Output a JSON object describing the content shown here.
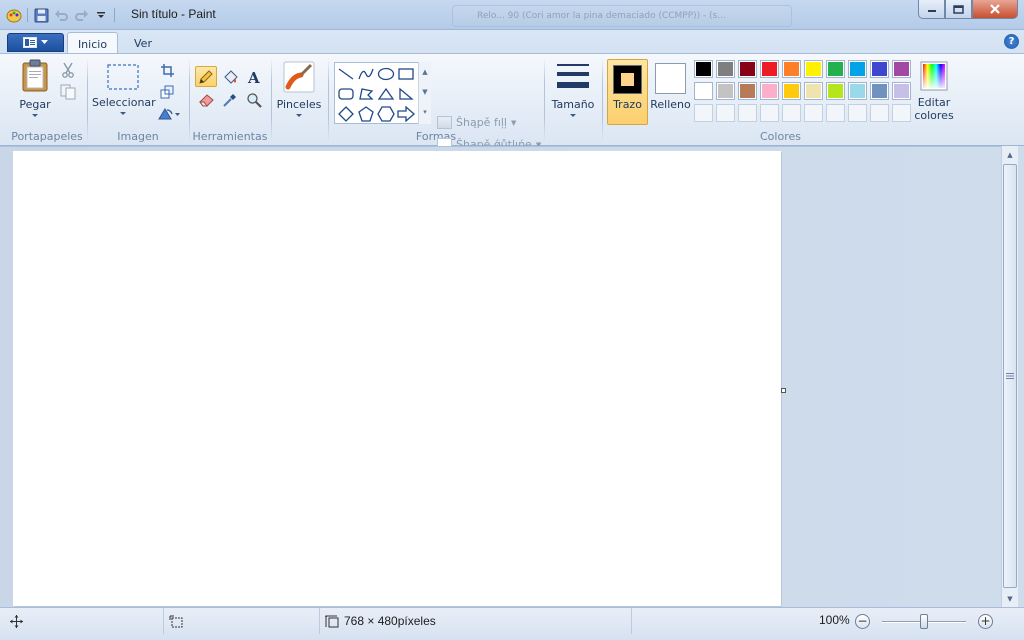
{
  "window": {
    "title": "Sin título - Paint",
    "ghost_tab_text": "Relo... 90 (Cori amor la pina demaciado (CCMPP)) - (s..."
  },
  "tabs": {
    "inicio": "Inicio",
    "ver": "Ver"
  },
  "groups": {
    "portapapeles": {
      "label": "Portapapeles",
      "pegar": "Pegar"
    },
    "imagen": {
      "label": "Imagen",
      "seleccionar": "Seleccionar"
    },
    "herramientas": {
      "label": "Herramientas"
    },
    "pinceles": {
      "label": "Pinceles"
    },
    "formas": {
      "label": "Formas",
      "fill": "Ŝhąpě fıļļ",
      "outline": "Ŝhąpě ǿůţļıńę"
    },
    "tamano": {
      "label": "Tamaño"
    },
    "colores": {
      "label": "Colores",
      "trazo": "Trazo",
      "relleno": "Relleno",
      "editar_line1": "Editar",
      "editar_line2": "colores",
      "row1": [
        "#000000",
        "#7f7f7f",
        "#880015",
        "#ed1c24",
        "#ff7f27",
        "#fff200",
        "#22b14c",
        "#00a2e8",
        "#3f48cc",
        "#a349a4"
      ],
      "row2": [
        "#ffffff",
        "#c3c3c3",
        "#b97a57",
        "#ffaec9",
        "#ffc90e",
        "#efe4b0",
        "#b5e61d",
        "#99d9ea",
        "#7092be",
        "#c8bfe7"
      ],
      "trazo_color": "#000000",
      "relleno_color": "#ffffff"
    }
  },
  "status": {
    "dimensions": "768 × 480píxeles",
    "zoom": "100%",
    "zoom_percent": 100
  }
}
